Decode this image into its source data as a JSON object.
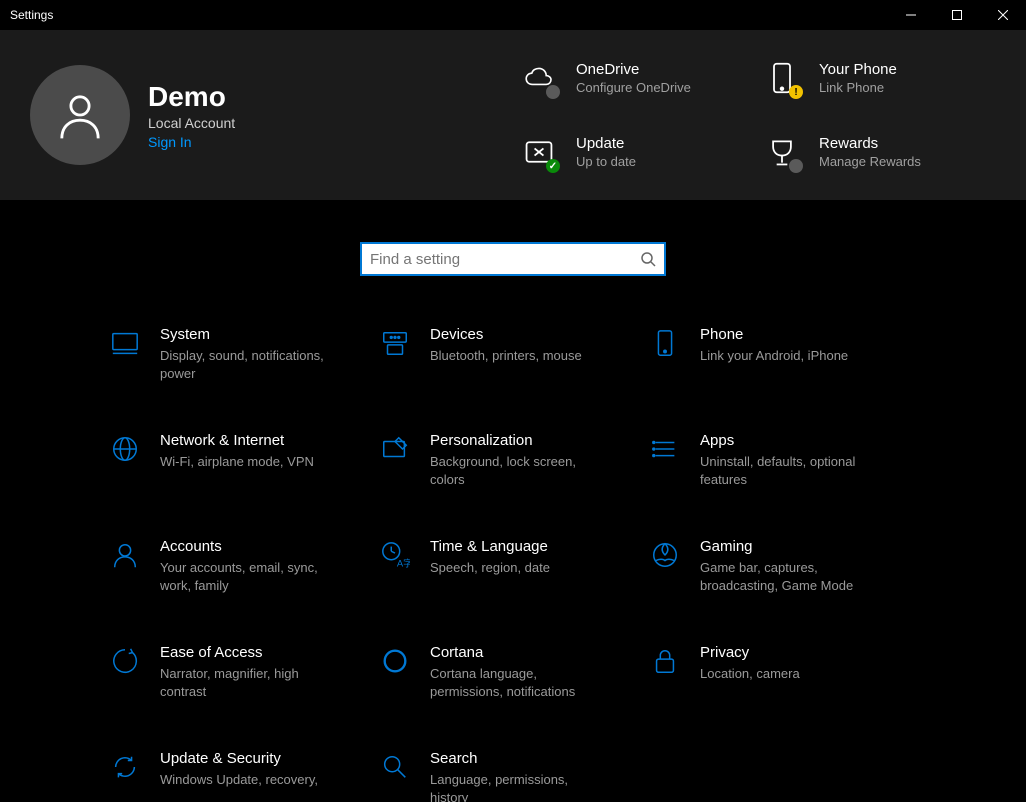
{
  "window": {
    "title": "Settings"
  },
  "account": {
    "name": "Demo",
    "type": "Local Account",
    "signin": "Sign In"
  },
  "tiles": {
    "onedrive": {
      "label": "OneDrive",
      "sub": "Configure OneDrive"
    },
    "yourphone": {
      "label": "Your Phone",
      "sub": "Link Phone"
    },
    "update": {
      "label": "Update",
      "sub": "Up to date"
    },
    "rewards": {
      "label": "Rewards",
      "sub": "Manage Rewards"
    }
  },
  "search": {
    "placeholder": "Find a setting"
  },
  "categories": {
    "system": {
      "label": "System",
      "sub": "Display, sound, notifications, power"
    },
    "devices": {
      "label": "Devices",
      "sub": "Bluetooth, printers, mouse"
    },
    "phone": {
      "label": "Phone",
      "sub": "Link your Android, iPhone"
    },
    "network": {
      "label": "Network & Internet",
      "sub": "Wi-Fi, airplane mode, VPN"
    },
    "personalization": {
      "label": "Personalization",
      "sub": "Background, lock screen, colors"
    },
    "apps": {
      "label": "Apps",
      "sub": "Uninstall, defaults, optional features"
    },
    "accounts": {
      "label": "Accounts",
      "sub": "Your accounts, email, sync, work, family"
    },
    "timelang": {
      "label": "Time & Language",
      "sub": "Speech, region, date"
    },
    "gaming": {
      "label": "Gaming",
      "sub": "Game bar, captures, broadcasting, Game Mode"
    },
    "ease": {
      "label": "Ease of Access",
      "sub": "Narrator, magnifier, high contrast"
    },
    "cortana": {
      "label": "Cortana",
      "sub": "Cortana language, permissions, notifications"
    },
    "privacy": {
      "label": "Privacy",
      "sub": "Location, camera"
    },
    "updatesec": {
      "label": "Update & Security",
      "sub": "Windows Update, recovery,"
    },
    "searchcat": {
      "label": "Search",
      "sub": "Language, permissions, history"
    }
  }
}
